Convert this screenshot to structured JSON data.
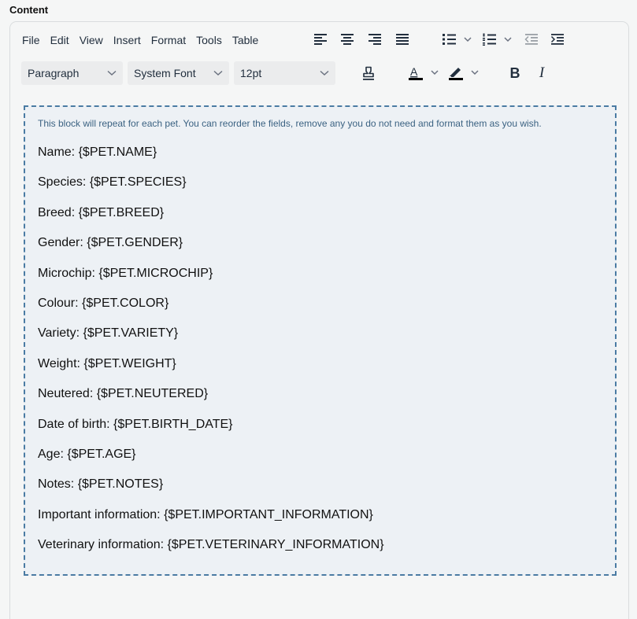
{
  "field_label": "Content",
  "menubar": [
    "File",
    "Edit",
    "View",
    "Insert",
    "Format",
    "Tools",
    "Table"
  ],
  "toolbar": {
    "block_format": "Paragraph",
    "font_family": "System Font",
    "font_size": "12pt",
    "bold_label": "B",
    "italic_label": "I",
    "text_color": "#000000",
    "highlight_color": "#000000"
  },
  "block": {
    "note": "This block will repeat for each pet. You can reorder the fields, remove any you do not need and format them as you wish.",
    "fields": [
      "Name: {$PET.NAME}",
      "Species: {$PET.SPECIES}",
      "Breed: {$PET.BREED}",
      "Gender: {$PET.GENDER}",
      "Microchip: {$PET.MICROCHIP}",
      "Colour: {$PET.COLOR}",
      "Variety: {$PET.VARIETY}",
      "Weight: {$PET.WEIGHT}",
      "Neutered: {$PET.NEUTERED}",
      "Date of birth: {$PET.BIRTH_DATE}",
      "Age: {$PET.AGE}",
      "Notes: {$PET.NOTES}",
      "Important information: {$PET.IMPORTANT_INFORMATION}",
      "Veterinary information: {$PET.VETERINARY_INFORMATION}"
    ]
  },
  "colors": {
    "block_border": "#4a7ba3",
    "block_background": "#edf1f5",
    "note_text": "#3b6282",
    "toolbar_text": "#222f3e"
  }
}
